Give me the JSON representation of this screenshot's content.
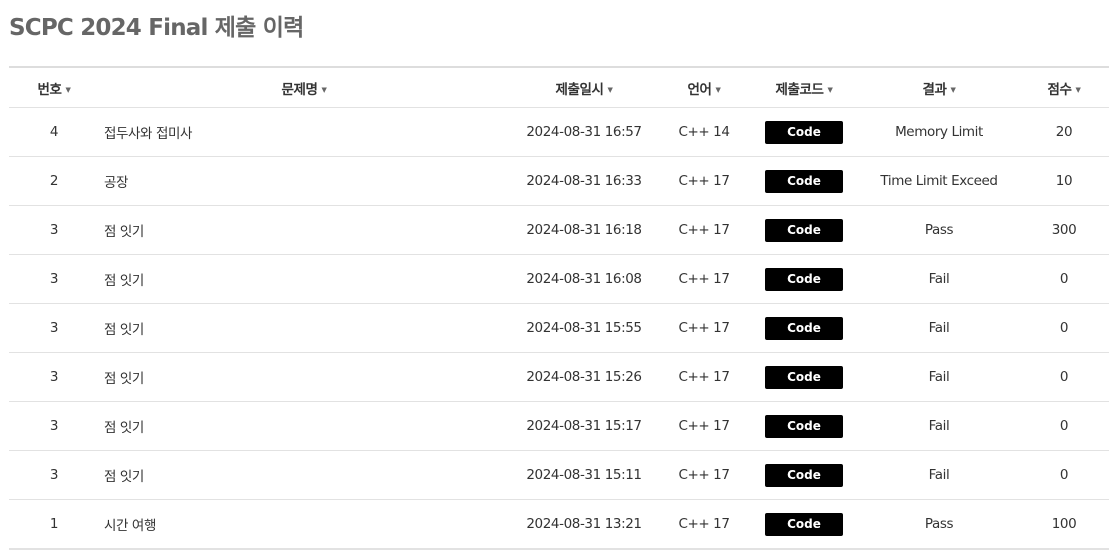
{
  "page": {
    "title": "SCPC 2024 Final 제출 이력"
  },
  "table": {
    "sort_icon": "caret-down-icon",
    "columns": [
      {
        "key": "no",
        "label": "번호"
      },
      {
        "key": "problem",
        "label": "문제명"
      },
      {
        "key": "submitted_at",
        "label": "제출일시"
      },
      {
        "key": "language",
        "label": "언어"
      },
      {
        "key": "code",
        "label": "제출코드"
      },
      {
        "key": "result",
        "label": "결과"
      },
      {
        "key": "score",
        "label": "점수"
      }
    ],
    "rows": [
      {
        "no": "4",
        "problem": "접두사와 접미사",
        "submitted_at": "2024-08-31 16:57",
        "language": "C++ 14",
        "code_label": "Code",
        "result": "Memory Limit",
        "score": "20"
      },
      {
        "no": "2",
        "problem": "공장",
        "submitted_at": "2024-08-31 16:33",
        "language": "C++ 17",
        "code_label": "Code",
        "result": "Time Limit Exceed",
        "score": "10"
      },
      {
        "no": "3",
        "problem": "점 잇기",
        "submitted_at": "2024-08-31 16:18",
        "language": "C++ 17",
        "code_label": "Code",
        "result": "Pass",
        "score": "300"
      },
      {
        "no": "3",
        "problem": "점 잇기",
        "submitted_at": "2024-08-31 16:08",
        "language": "C++ 17",
        "code_label": "Code",
        "result": "Fail",
        "score": "0"
      },
      {
        "no": "3",
        "problem": "점 잇기",
        "submitted_at": "2024-08-31 15:55",
        "language": "C++ 17",
        "code_label": "Code",
        "result": "Fail",
        "score": "0"
      },
      {
        "no": "3",
        "problem": "점 잇기",
        "submitted_at": "2024-08-31 15:26",
        "language": "C++ 17",
        "code_label": "Code",
        "result": "Fail",
        "score": "0"
      },
      {
        "no": "3",
        "problem": "점 잇기",
        "submitted_at": "2024-08-31 15:17",
        "language": "C++ 17",
        "code_label": "Code",
        "result": "Fail",
        "score": "0"
      },
      {
        "no": "3",
        "problem": "점 잇기",
        "submitted_at": "2024-08-31 15:11",
        "language": "C++ 17",
        "code_label": "Code",
        "result": "Fail",
        "score": "0"
      },
      {
        "no": "1",
        "problem": "시간 여행",
        "submitted_at": "2024-08-31 13:21",
        "language": "C++ 17",
        "code_label": "Code",
        "result": "Pass",
        "score": "100"
      }
    ]
  }
}
